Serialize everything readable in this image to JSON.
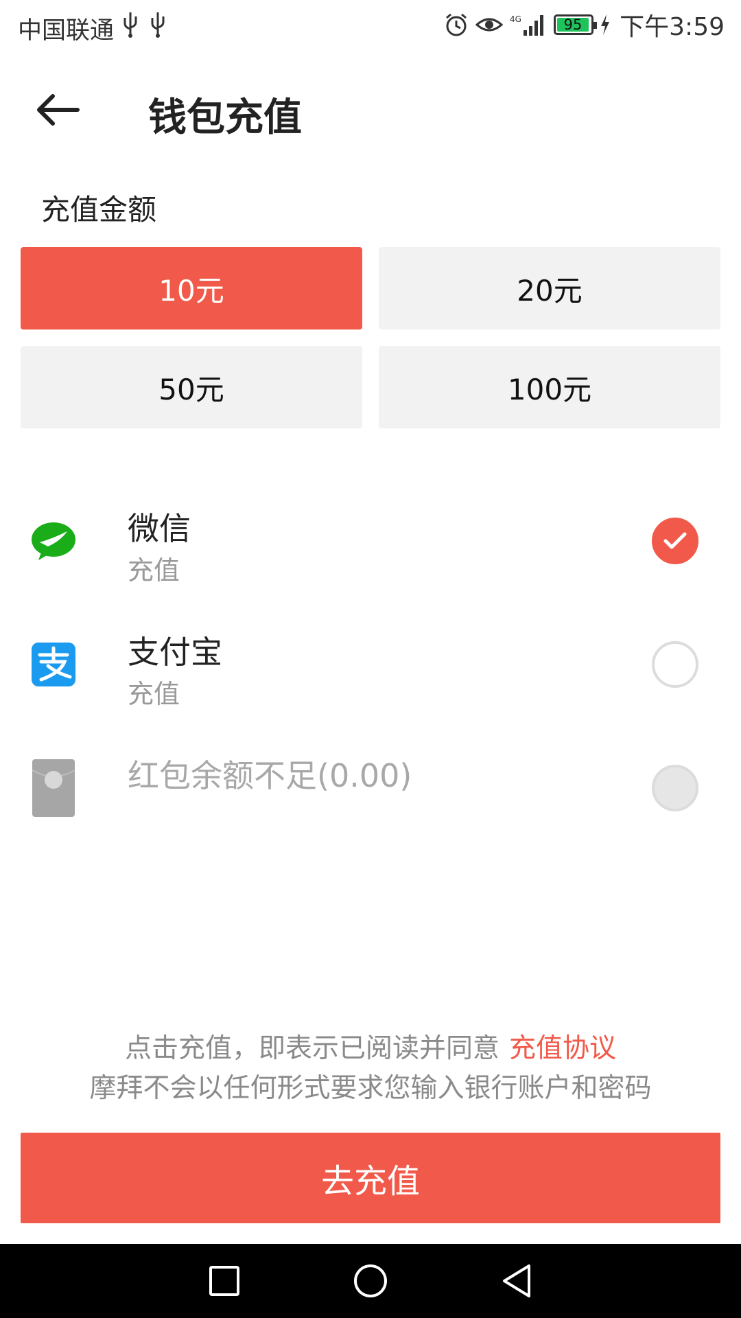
{
  "status_bar": {
    "carrier": "中国联通",
    "network": "4G",
    "battery": "95",
    "time": "下午3:59"
  },
  "header": {
    "title": "钱包充值",
    "back_icon": "arrow-left-icon"
  },
  "amount": {
    "label": "充值金额",
    "options": [
      {
        "label": "10元",
        "selected": true
      },
      {
        "label": "20元",
        "selected": false
      },
      {
        "label": "50元",
        "selected": false
      },
      {
        "label": "100元",
        "selected": false
      }
    ]
  },
  "payment": {
    "methods": [
      {
        "name": "微信",
        "sub": "充值",
        "icon": "wechat-icon",
        "state": "checked"
      },
      {
        "name": "支付宝",
        "sub": "充值",
        "icon": "alipay-icon",
        "state": "unchecked"
      },
      {
        "name": "红包余额不足(0.00)",
        "sub": "",
        "icon": "red-packet-icon",
        "state": "disabled"
      }
    ]
  },
  "agreement": {
    "text": "点击充值，即表示已阅读并同意",
    "link": "充值协议",
    "notice": "摩拜不会以任何形式要求您输入银行账户和密码"
  },
  "submit": {
    "label": "去充值"
  },
  "colors": {
    "accent": "#f15a4a",
    "wechat": "#1aad19",
    "alipay": "#1b9bf0"
  }
}
